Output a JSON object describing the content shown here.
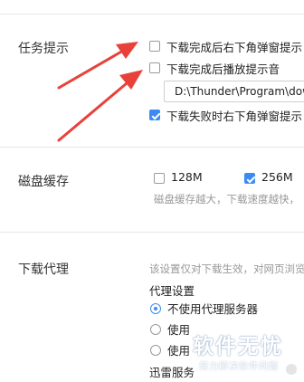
{
  "notify": {
    "title": "任务提示",
    "option1": "下载完成后右下角弹窗提示",
    "option2": "下载完成后播放提示音",
    "sound_path": "D:\\Thunder\\Program\\dow",
    "option3": "下载失败时右下角弹窗提示"
  },
  "cache": {
    "title": "磁盘缓存",
    "option_128": "128M",
    "option_256": "256M",
    "selected": "256M",
    "hint": "磁盘缓存越大，下载速度越快，"
  },
  "proxy": {
    "title": "下载代理",
    "hint": "该设置仅对下载生效，对网页浏览",
    "subtitle": "代理设置",
    "radio1": "不使用代理服务器",
    "radio2_partial": "使用",
    "radio3_partial": "使用",
    "footer_partial": "迅雷服务"
  },
  "watermark": {
    "main": "软件无忧",
    "sub": "努力解决软件问题"
  },
  "colors": {
    "accent": "#3d8bf2",
    "arrow": "#e8413a"
  }
}
